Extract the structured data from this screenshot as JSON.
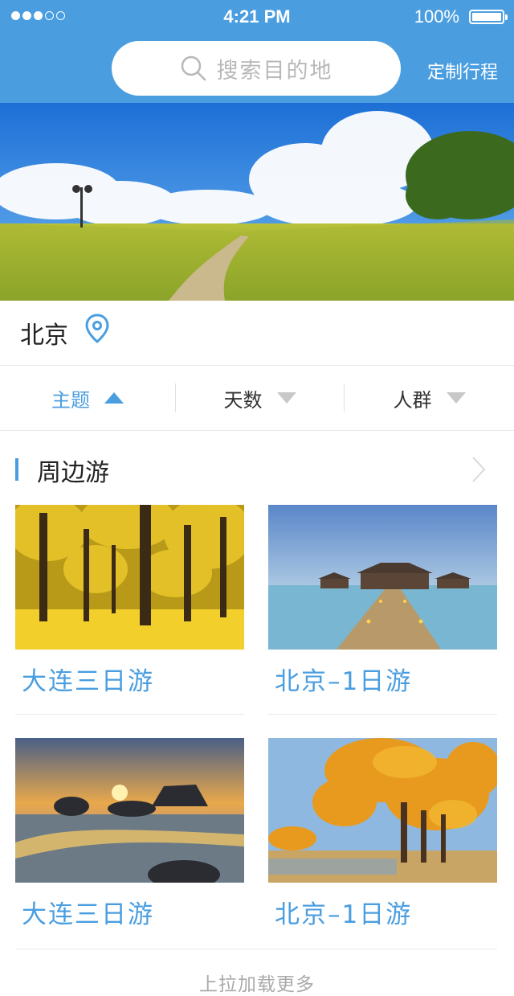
{
  "status_bar": {
    "time": "4:21 PM",
    "battery": "100%"
  },
  "search": {
    "placeholder": "搜索目的地"
  },
  "header": {
    "custom_trip": "定制行程"
  },
  "city": {
    "name": "北京"
  },
  "filters": [
    {
      "label": "主题",
      "active": true
    },
    {
      "label": "天数",
      "active": false
    },
    {
      "label": "人群",
      "active": false
    }
  ],
  "section": {
    "title": "周边游"
  },
  "cards": [
    {
      "title": "大连三日游",
      "image": "golden-ginkgo-forest"
    },
    {
      "title": "北京–1日游",
      "image": "overwater-villa-pier"
    },
    {
      "title": "大连三日游",
      "image": "sunset-beach-rocks"
    },
    {
      "title": "北京–1日游",
      "image": "autumn-poplar-trees"
    }
  ],
  "footer": {
    "load_more": "上拉加载更多"
  },
  "colors": {
    "accent": "#4a9ee0"
  }
}
